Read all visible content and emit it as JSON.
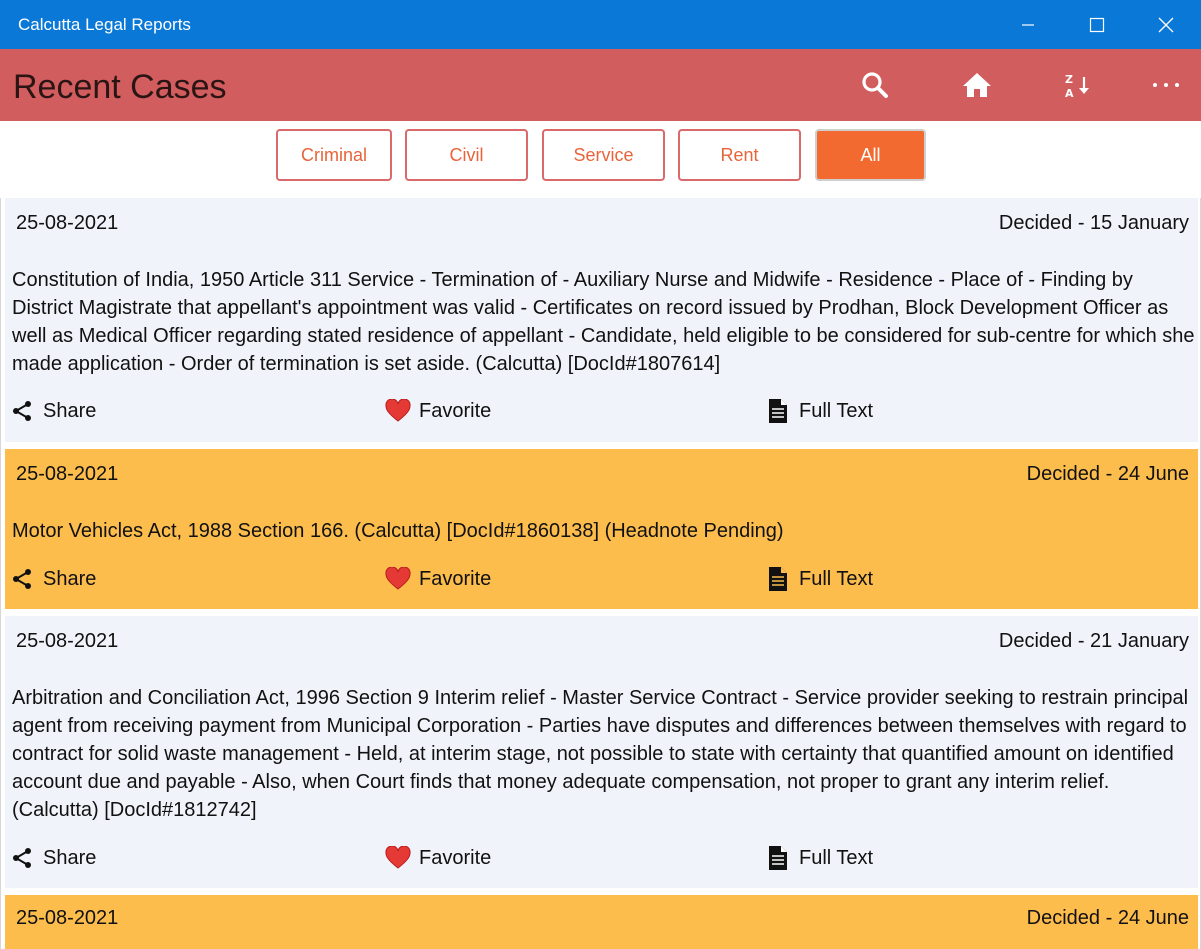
{
  "window": {
    "title": "Calcutta Legal Reports",
    "controls": [
      "minimize-icon",
      "maximize-icon",
      "close-icon"
    ]
  },
  "header": {
    "title": "Recent Cases",
    "icons": [
      "search-icon",
      "home-icon",
      "sort-za-icon",
      "more-icon"
    ]
  },
  "filters": [
    {
      "label": "Criminal",
      "active": false
    },
    {
      "label": "Civil",
      "active": false
    },
    {
      "label": "Service",
      "active": false
    },
    {
      "label": "Rent",
      "active": false
    },
    {
      "label": "All",
      "active": true
    }
  ],
  "colors": {
    "titlebar": "#0a78d7",
    "header": "#d15d5e",
    "accent": "#f26a30",
    "card_light": "#f0f3fa",
    "card_dark": "#fcbd4d",
    "heart": "#e53935"
  },
  "cases": [
    {
      "date": "25-08-2021",
      "decided": "Decided - 15 January",
      "headnote": "Constitution of India, 1950 Article 311 Service - Termination of - Auxiliary Nurse and Midwife - Residence - Place of - Finding by District Magistrate that appellant's appointment was valid - Certificates on record issued by Prodhan, Block Development Officer as well as Medical Officer regarding stated residence of appellant - Candidate, held eligible to be considered for sub-centre for which she made application - Order of termination is set aside. (Calcutta) [DocId#1807614]",
      "share": "Share",
      "favorite": "Favorite",
      "fulltext": "Full Text"
    },
    {
      "date": "25-08-2021",
      "decided": "Decided - 24 June",
      "headnote": "Motor Vehicles Act, 1988 Section 166. (Calcutta) [DocId#1860138] (Headnote Pending)",
      "share": "Share",
      "favorite": "Favorite",
      "fulltext": "Full Text"
    },
    {
      "date": "25-08-2021",
      "decided": "Decided - 21 January",
      "headnote": "Arbitration and Conciliation Act, 1996 Section 9 Interim relief - Master Service Contract - Service provider seeking to restrain principal agent from receiving payment from Municipal Corporation - Parties have disputes and differences between themselves with regard to contract for solid waste management - Held, at interim stage, not possible to state with certainty that quantified amount on identified account due and payable - Also, when Court finds that money adequate compensation, not proper to grant any interim relief. (Calcutta) [DocId#1812742]",
      "share": "Share",
      "favorite": "Favorite",
      "fulltext": "Full Text"
    },
    {
      "date": "25-08-2021",
      "decided": "Decided - 24 June"
    }
  ]
}
